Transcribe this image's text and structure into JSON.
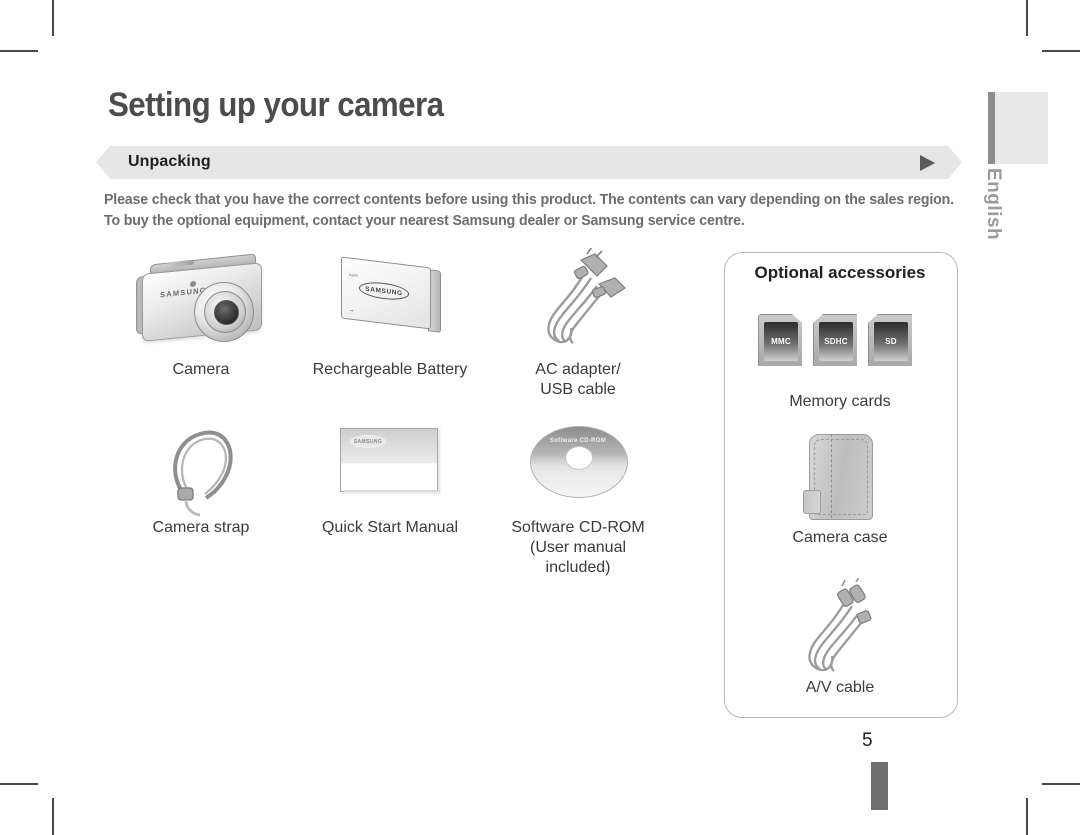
{
  "page": {
    "title": "Setting up your camera",
    "section_label": "Unpacking",
    "intro_line1": "Please check that you have the correct contents before using this product. The contents can vary depending on the sales region.",
    "intro_line2": "To buy the optional equipment, contact your nearest Samsung dealer or Samsung service centre.",
    "language_tab": "English",
    "page_number": "5",
    "brand": "SAMSUNG",
    "accent_color": "#e6e6e6",
    "title_color": "#4c4c4c",
    "text_color": "#6d6d6d"
  },
  "items": [
    {
      "caption": "Camera",
      "caption2": ""
    },
    {
      "caption": "Rechargeable Battery",
      "caption2": ""
    },
    {
      "caption": "AC adapter/",
      "caption2": "USB cable"
    },
    {
      "caption": "Camera strap",
      "caption2": ""
    },
    {
      "caption": "Quick Start Manual",
      "caption2": ""
    },
    {
      "caption": "Software CD-ROM",
      "caption2": "(User manual included)"
    }
  ],
  "cd": {
    "label": "Software CD-ROM"
  },
  "optional": {
    "title": "Optional accessories",
    "memory_cards_caption": "Memory cards",
    "cards": [
      {
        "label": "MMC"
      },
      {
        "label": "SDHC"
      },
      {
        "label": "SD"
      }
    ],
    "case_caption": "Camera case",
    "av_caption": "A/V cable"
  }
}
